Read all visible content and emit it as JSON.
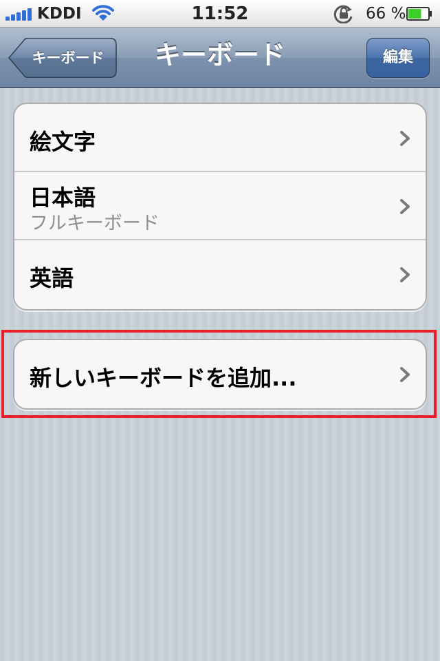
{
  "status_bar": {
    "carrier": "KDDI",
    "time": "11:52",
    "battery_percent": "66 %",
    "battery_level": 0.66,
    "signal_bars": 5,
    "icons": [
      "signal-bars-icon",
      "wifi-icon",
      "rotation-lock-icon",
      "battery-icon"
    ]
  },
  "nav_bar": {
    "back_label": "キーボード",
    "title": "キーボード",
    "edit_label": "編集"
  },
  "keyboards": [
    {
      "title": "絵文字",
      "subtitle": ""
    },
    {
      "title": "日本語",
      "subtitle": "フルキーボード"
    },
    {
      "title": "英語",
      "subtitle": ""
    }
  ],
  "add_keyboard": {
    "label": "新しいキーボードを追加..."
  },
  "colors": {
    "nav_bar": "#7d92ad",
    "edit_button": "#3c649f",
    "highlight": "#e8202a",
    "background": "#c5ccd4",
    "battery_fill": "#3fcf2a"
  }
}
